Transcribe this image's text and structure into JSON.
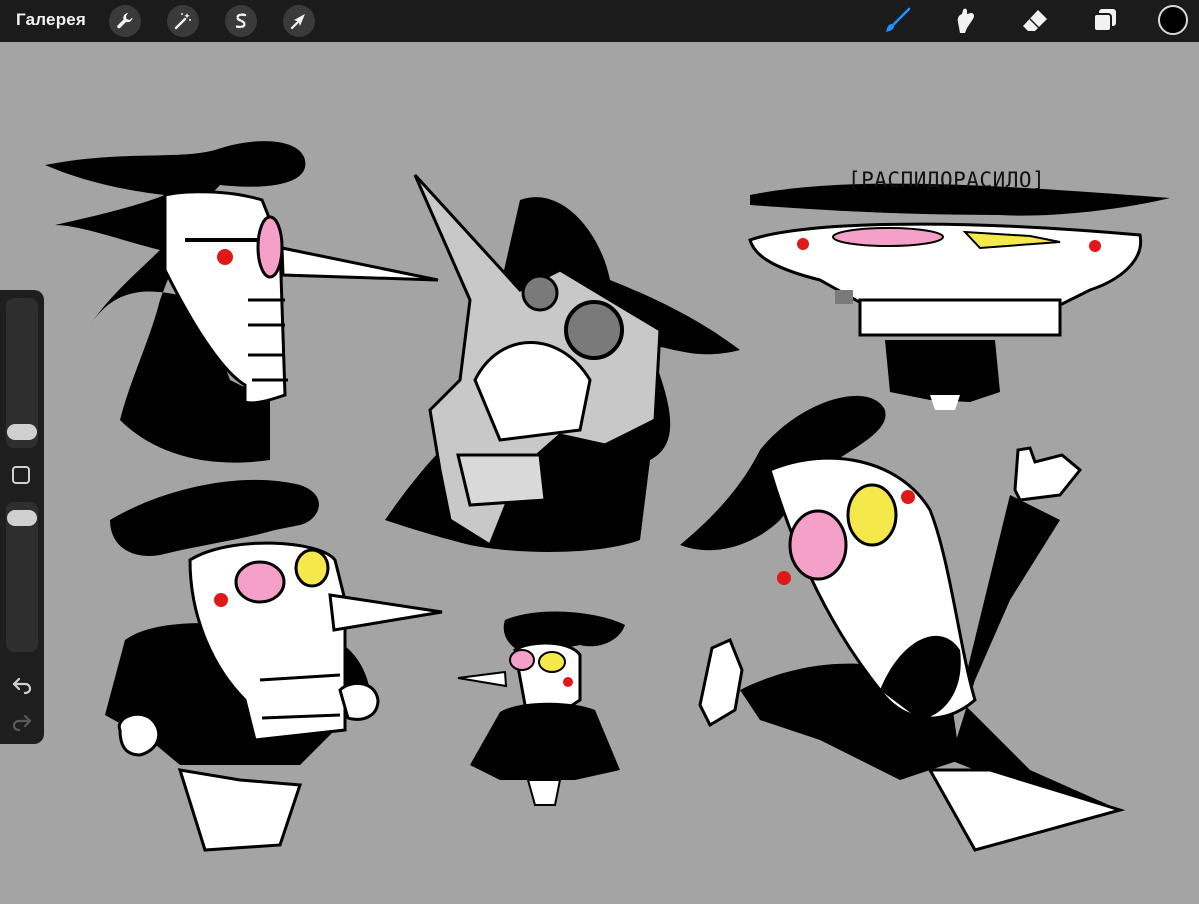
{
  "toolbar": {
    "gallery_label": "Галерея",
    "left_tools": [
      {
        "name": "actions",
        "icon": "wrench-icon"
      },
      {
        "name": "adjustments",
        "icon": "magic-wand-icon"
      },
      {
        "name": "selection",
        "icon": "selection-s-icon"
      },
      {
        "name": "transform",
        "icon": "arrow-cursor-icon"
      }
    ],
    "right_tools": [
      {
        "name": "brush",
        "icon": "brush-icon",
        "active": true
      },
      {
        "name": "smudge",
        "icon": "smudge-finger-icon",
        "active": false
      },
      {
        "name": "eraser",
        "icon": "eraser-icon",
        "active": false
      },
      {
        "name": "layers",
        "icon": "layers-icon",
        "active": false
      }
    ],
    "current_color": "#000000",
    "active_tool_color": "#1e8fff"
  },
  "sidebar": {
    "brush_size_level": 0.3,
    "opacity_level": 0.95,
    "modify_icon": "square-icon",
    "undo_icon": "undo-arrow-icon",
    "redo_icon": "redo-arrow-icon"
  },
  "canvas": {
    "background": "#a4a4a4",
    "caption_text": "[РАСПИДОРАСИЛО]",
    "drawing_colors": {
      "ink": "#000000",
      "white": "#ffffff",
      "pink": "#f4a0c8",
      "yellow": "#f5e84a",
      "red": "#e01818",
      "gray": "#c8c8c8"
    }
  }
}
